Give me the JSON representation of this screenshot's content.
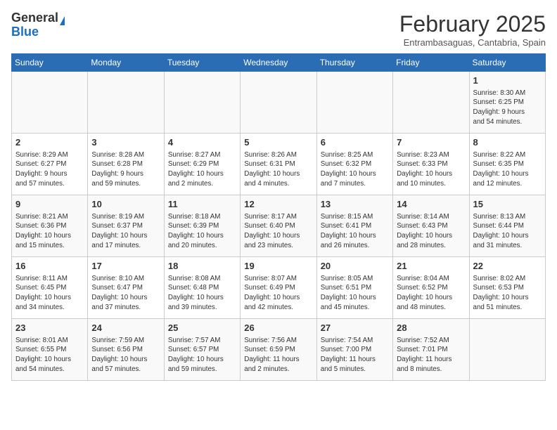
{
  "logo": {
    "line1": "General",
    "line2": "Blue"
  },
  "title": "February 2025",
  "subtitle": "Entrambasaguas, Cantabria, Spain",
  "days_of_week": [
    "Sunday",
    "Monday",
    "Tuesday",
    "Wednesday",
    "Thursday",
    "Friday",
    "Saturday"
  ],
  "weeks": [
    [
      {
        "day": "",
        "detail": ""
      },
      {
        "day": "",
        "detail": ""
      },
      {
        "day": "",
        "detail": ""
      },
      {
        "day": "",
        "detail": ""
      },
      {
        "day": "",
        "detail": ""
      },
      {
        "day": "",
        "detail": ""
      },
      {
        "day": "1",
        "detail": "Sunrise: 8:30 AM\nSunset: 6:25 PM\nDaylight: 9 hours\nand 54 minutes."
      }
    ],
    [
      {
        "day": "2",
        "detail": "Sunrise: 8:29 AM\nSunset: 6:27 PM\nDaylight: 9 hours\nand 57 minutes."
      },
      {
        "day": "3",
        "detail": "Sunrise: 8:28 AM\nSunset: 6:28 PM\nDaylight: 9 hours\nand 59 minutes."
      },
      {
        "day": "4",
        "detail": "Sunrise: 8:27 AM\nSunset: 6:29 PM\nDaylight: 10 hours\nand 2 minutes."
      },
      {
        "day": "5",
        "detail": "Sunrise: 8:26 AM\nSunset: 6:31 PM\nDaylight: 10 hours\nand 4 minutes."
      },
      {
        "day": "6",
        "detail": "Sunrise: 8:25 AM\nSunset: 6:32 PM\nDaylight: 10 hours\nand 7 minutes."
      },
      {
        "day": "7",
        "detail": "Sunrise: 8:23 AM\nSunset: 6:33 PM\nDaylight: 10 hours\nand 10 minutes."
      },
      {
        "day": "8",
        "detail": "Sunrise: 8:22 AM\nSunset: 6:35 PM\nDaylight: 10 hours\nand 12 minutes."
      }
    ],
    [
      {
        "day": "9",
        "detail": "Sunrise: 8:21 AM\nSunset: 6:36 PM\nDaylight: 10 hours\nand 15 minutes."
      },
      {
        "day": "10",
        "detail": "Sunrise: 8:19 AM\nSunset: 6:37 PM\nDaylight: 10 hours\nand 17 minutes."
      },
      {
        "day": "11",
        "detail": "Sunrise: 8:18 AM\nSunset: 6:39 PM\nDaylight: 10 hours\nand 20 minutes."
      },
      {
        "day": "12",
        "detail": "Sunrise: 8:17 AM\nSunset: 6:40 PM\nDaylight: 10 hours\nand 23 minutes."
      },
      {
        "day": "13",
        "detail": "Sunrise: 8:15 AM\nSunset: 6:41 PM\nDaylight: 10 hours\nand 26 minutes."
      },
      {
        "day": "14",
        "detail": "Sunrise: 8:14 AM\nSunset: 6:43 PM\nDaylight: 10 hours\nand 28 minutes."
      },
      {
        "day": "15",
        "detail": "Sunrise: 8:13 AM\nSunset: 6:44 PM\nDaylight: 10 hours\nand 31 minutes."
      }
    ],
    [
      {
        "day": "16",
        "detail": "Sunrise: 8:11 AM\nSunset: 6:45 PM\nDaylight: 10 hours\nand 34 minutes."
      },
      {
        "day": "17",
        "detail": "Sunrise: 8:10 AM\nSunset: 6:47 PM\nDaylight: 10 hours\nand 37 minutes."
      },
      {
        "day": "18",
        "detail": "Sunrise: 8:08 AM\nSunset: 6:48 PM\nDaylight: 10 hours\nand 39 minutes."
      },
      {
        "day": "19",
        "detail": "Sunrise: 8:07 AM\nSunset: 6:49 PM\nDaylight: 10 hours\nand 42 minutes."
      },
      {
        "day": "20",
        "detail": "Sunrise: 8:05 AM\nSunset: 6:51 PM\nDaylight: 10 hours\nand 45 minutes."
      },
      {
        "day": "21",
        "detail": "Sunrise: 8:04 AM\nSunset: 6:52 PM\nDaylight: 10 hours\nand 48 minutes."
      },
      {
        "day": "22",
        "detail": "Sunrise: 8:02 AM\nSunset: 6:53 PM\nDaylight: 10 hours\nand 51 minutes."
      }
    ],
    [
      {
        "day": "23",
        "detail": "Sunrise: 8:01 AM\nSunset: 6:55 PM\nDaylight: 10 hours\nand 54 minutes."
      },
      {
        "day": "24",
        "detail": "Sunrise: 7:59 AM\nSunset: 6:56 PM\nDaylight: 10 hours\nand 57 minutes."
      },
      {
        "day": "25",
        "detail": "Sunrise: 7:57 AM\nSunset: 6:57 PM\nDaylight: 10 hours\nand 59 minutes."
      },
      {
        "day": "26",
        "detail": "Sunrise: 7:56 AM\nSunset: 6:59 PM\nDaylight: 11 hours\nand 2 minutes."
      },
      {
        "day": "27",
        "detail": "Sunrise: 7:54 AM\nSunset: 7:00 PM\nDaylight: 11 hours\nand 5 minutes."
      },
      {
        "day": "28",
        "detail": "Sunrise: 7:52 AM\nSunset: 7:01 PM\nDaylight: 11 hours\nand 8 minutes."
      },
      {
        "day": "",
        "detail": ""
      }
    ]
  ]
}
